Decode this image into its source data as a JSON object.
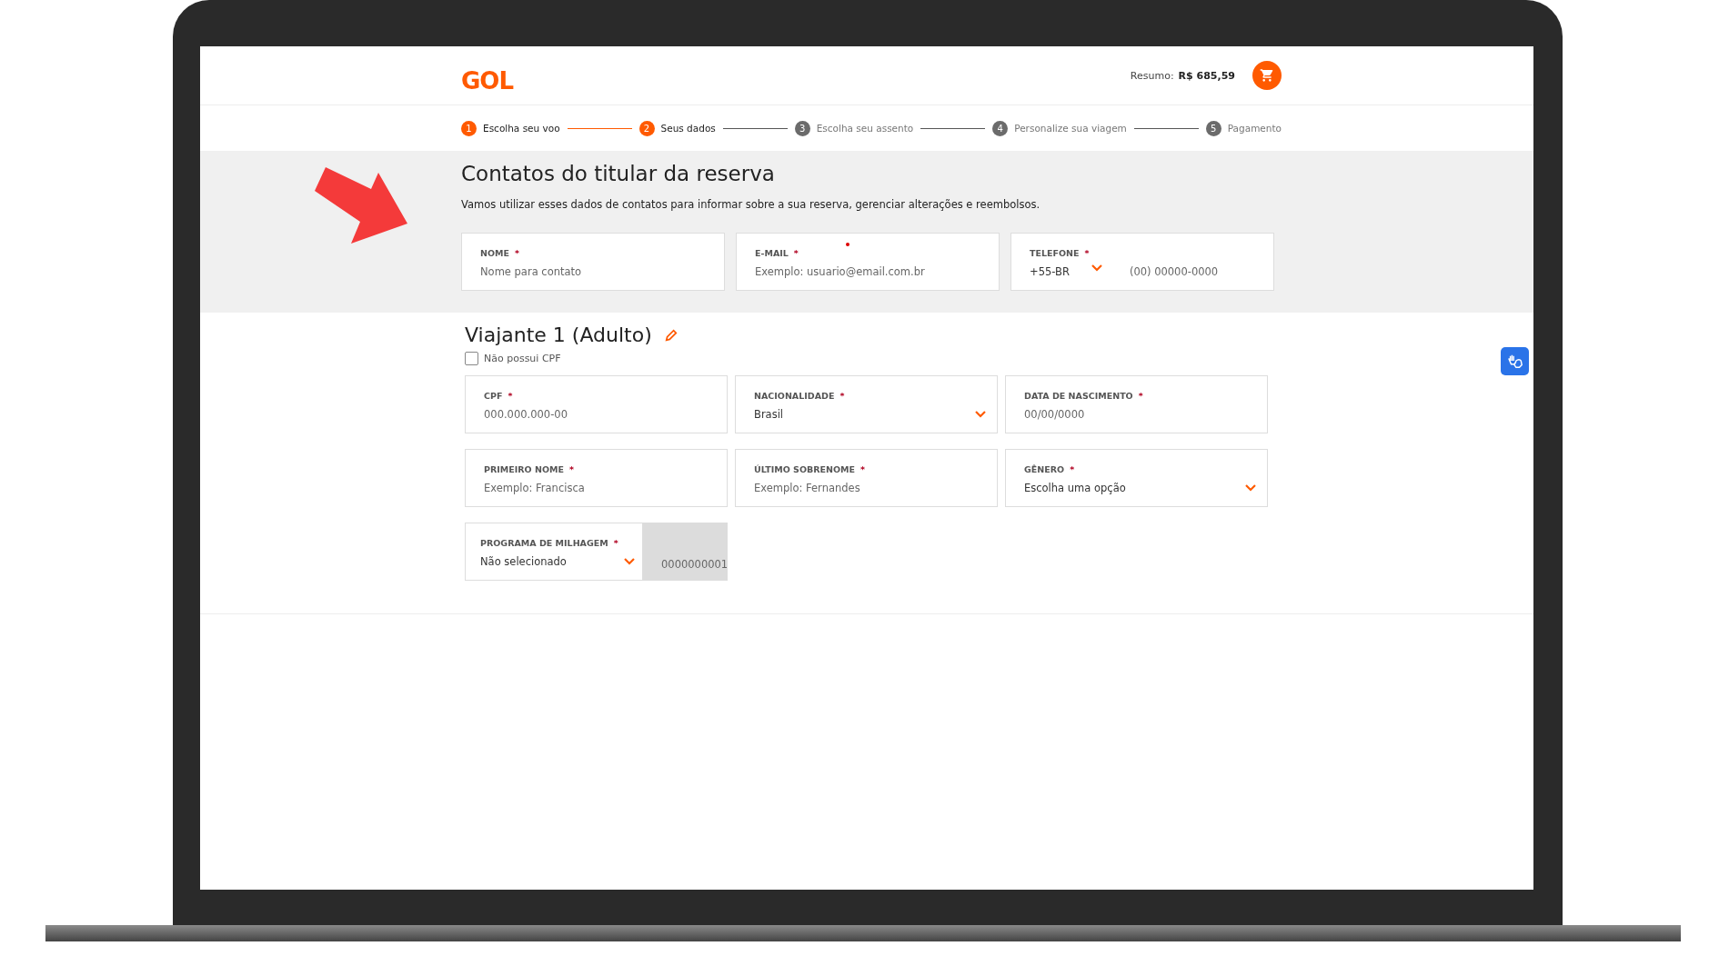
{
  "header": {
    "logo": "GOL",
    "summary_label": "Resumo:",
    "summary_value": "R$ 685,59"
  },
  "steps": [
    {
      "number": "1",
      "label": "Escolha seu voo",
      "active": true
    },
    {
      "number": "2",
      "label": "Seus dados",
      "active": true
    },
    {
      "number": "3",
      "label": "Escolha seu assento",
      "active": false
    },
    {
      "number": "4",
      "label": "Personalize sua viagem",
      "active": false
    },
    {
      "number": "5",
      "label": "Pagamento",
      "active": false
    }
  ],
  "contact": {
    "title": "Contatos do titular da reserva",
    "description": "Vamos utilizar esses dados de contatos para informar sobre a sua reserva, gerenciar alterações e reembolsos.",
    "fields": [
      {
        "kind": "text",
        "label": "NOME",
        "required_mark": "*",
        "placeholder": "Nome para contato"
      },
      {
        "kind": "text",
        "label": "E-MAIL",
        "required_mark": "*",
        "placeholder": "Exemplo: usuario@email.com.br"
      },
      {
        "kind": "phone",
        "label": "TELEFONE",
        "required_mark": "*",
        "code": "+55-BR",
        "placeholder": "(00) 00000-0000"
      }
    ]
  },
  "traveler": {
    "title": "Viajante 1 (Adulto)",
    "no_cpf": {
      "label": "Não possui CPF",
      "checked": false
    },
    "rows": [
      [
        {
          "kind": "text",
          "label": "CPF",
          "required_mark": "*",
          "placeholder": "000.000.000-00"
        },
        {
          "kind": "select",
          "label": "NACIONALIDADE",
          "required_mark": "*",
          "value": "Brasil"
        },
        {
          "kind": "text",
          "label": "DATA DE NASCIMENTO",
          "required_mark": "*",
          "placeholder": "00/00/0000"
        }
      ],
      [
        {
          "kind": "text",
          "label": "PRIMEIRO NOME",
          "required_mark": "*",
          "placeholder": "Exemplo: Francisca"
        },
        {
          "kind": "text",
          "label": "ÚLTIMO SOBRENOME",
          "required_mark": "*",
          "placeholder": "Exemplo: Fernandes"
        },
        {
          "kind": "select",
          "label": "GÊNERO",
          "required_mark": "*",
          "value": "Escolha uma opção"
        }
      ],
      [
        {
          "kind": "miles",
          "label": "PROGRAMA DE MILHAGEM",
          "required_mark": "*",
          "value": "Não selecionado",
          "number": "0000000001"
        }
      ]
    ]
  }
}
